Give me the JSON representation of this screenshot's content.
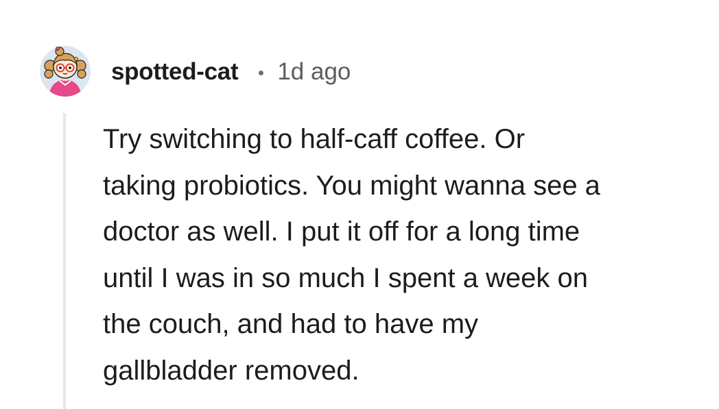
{
  "comment": {
    "author": "spotted-cat",
    "separator": "•",
    "timestamp": "1d ago",
    "avatar_icon": "cartoon-girl-avatar-icon",
    "body_lines": [
      "Try switching to half-caff coffee. Or",
      "taking probiotics. You might wanna see a",
      "doctor as well. I put it off for a long time",
      "until I was in so much I spent a week on",
      "the couch, and had to have my",
      "gallbladder removed."
    ]
  },
  "colors": {
    "text": "#1c1c1c",
    "meta": "#5c5c5c",
    "thread_line": "#e6e6e6",
    "avatar_bg": "#dce6ee",
    "avatar_shirt": "#e8498a"
  }
}
